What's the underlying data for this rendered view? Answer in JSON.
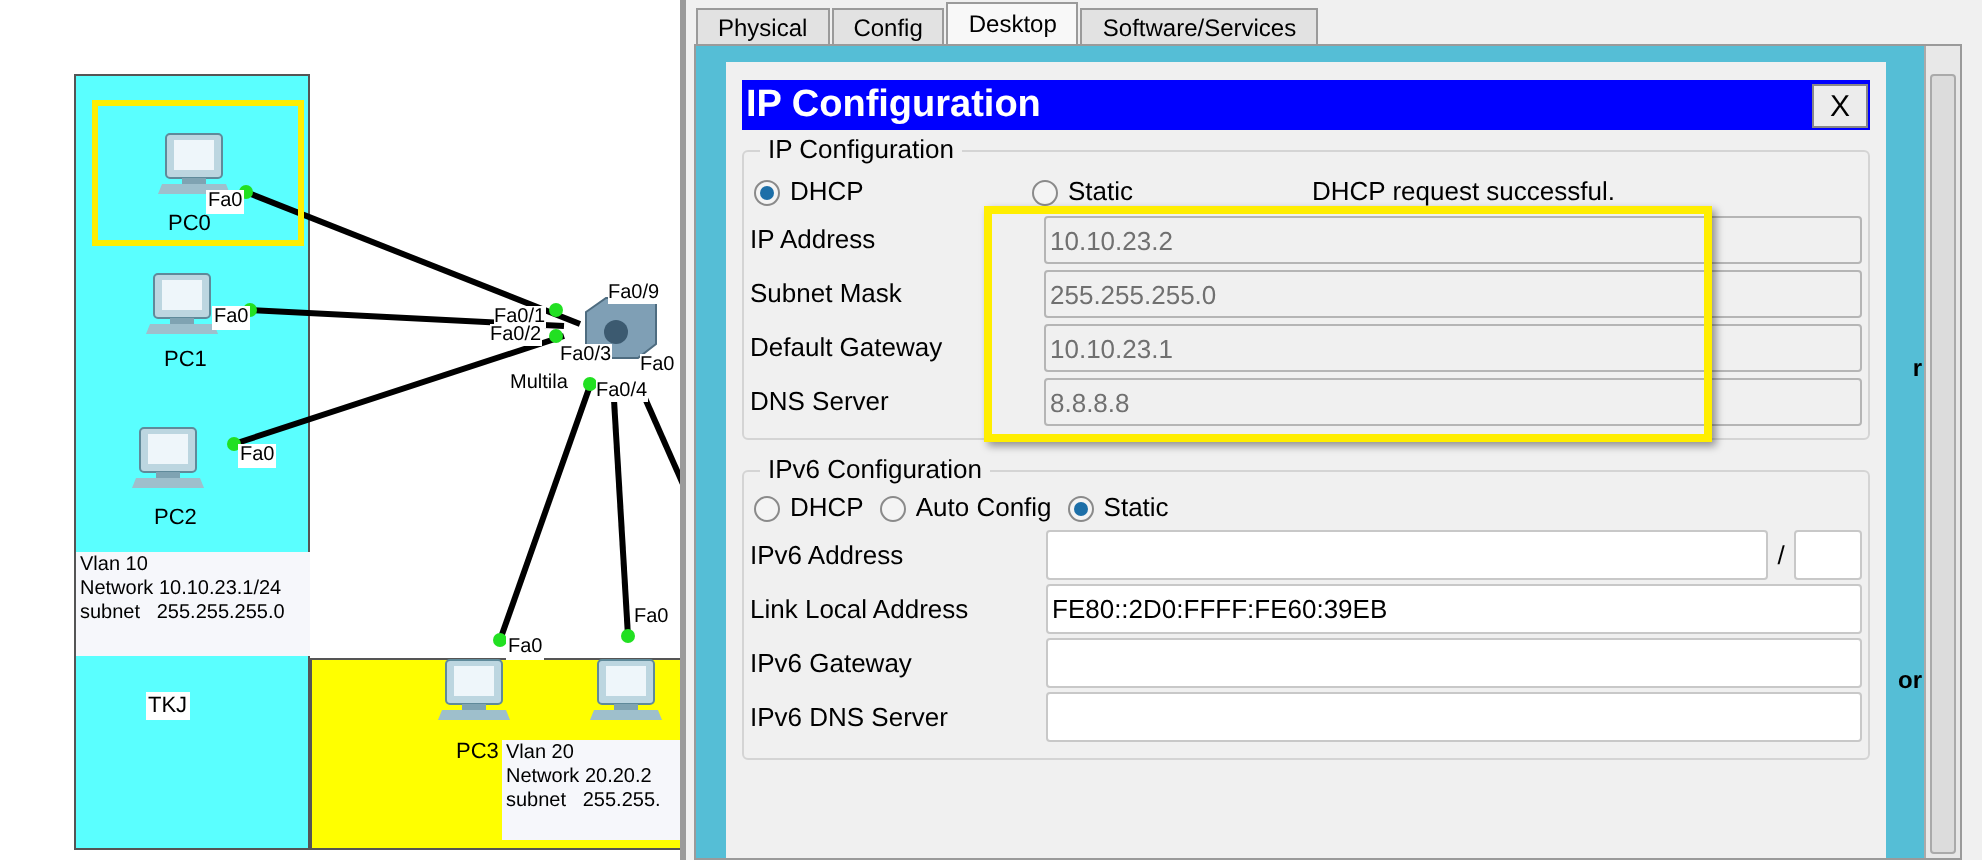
{
  "canvas": {
    "areas": [
      {
        "label": "TKJ",
        "color": "#5affff"
      },
      {
        "color": "#ffff00"
      }
    ],
    "devices": [
      {
        "name": "PC0",
        "port": "Fa0",
        "highlighted": true
      },
      {
        "name": "PC1",
        "port": "Fa0",
        "highlighted": false
      },
      {
        "name": "PC2",
        "port": "Fa0",
        "highlighted": false
      },
      {
        "name": "PC3",
        "port": "Fa0",
        "highlighted": false
      },
      {
        "port": "Fa0",
        "highlighted": false
      }
    ],
    "switch": {
      "name": "Multila",
      "ports": [
        "Fa0/9",
        "Fa0/1",
        "Fa0/2",
        "Fa0/3",
        "Fa0/4",
        "Fa0"
      ]
    },
    "notes": [
      {
        "lines": [
          "Vlan 10",
          "Network 10.10.23.1/24",
          "subnet   255.255.255.0"
        ]
      },
      {
        "lines": [
          "Vlan 20",
          "Network 20.20.2",
          "subnet   255.255."
        ]
      }
    ]
  },
  "window": {
    "tabs": [
      {
        "label": "Physical",
        "selected": false
      },
      {
        "label": "Config",
        "selected": false
      },
      {
        "label": "Desktop",
        "selected": true
      },
      {
        "label": "Software/Services",
        "selected": false
      }
    ],
    "behind_texts": [
      "r",
      "or"
    ],
    "dialog": {
      "title": "IP Configuration",
      "close": "X",
      "ipv4": {
        "legend": "IP Configuration",
        "highlighted": true,
        "status": "DHCP request successful.",
        "modes": [
          {
            "label": "DHCP",
            "selected": true
          },
          {
            "label": "Static",
            "selected": false
          }
        ],
        "fields": [
          {
            "label": "IP Address",
            "value": "10.10.23.2",
            "disabled": true
          },
          {
            "label": "Subnet Mask",
            "value": "255.255.255.0",
            "disabled": true
          },
          {
            "label": "Default Gateway",
            "value": "10.10.23.1",
            "disabled": true
          },
          {
            "label": "DNS Server",
            "value": "8.8.8.8",
            "disabled": true
          }
        ]
      },
      "ipv6": {
        "legend": "IPv6 Configuration",
        "modes": [
          {
            "label": "DHCP",
            "selected": false
          },
          {
            "label": "Auto Config",
            "selected": false
          },
          {
            "label": "Static",
            "selected": true
          }
        ],
        "address": {
          "label": "IPv6 Address",
          "separator": "/"
        },
        "fields": [
          {
            "label": "Link Local Address",
            "value": "FE80::2D0:FFFF:FE60:39EB"
          },
          {
            "label": "IPv6 Gateway"
          },
          {
            "label": "IPv6 DNS Server"
          }
        ]
      }
    }
  }
}
